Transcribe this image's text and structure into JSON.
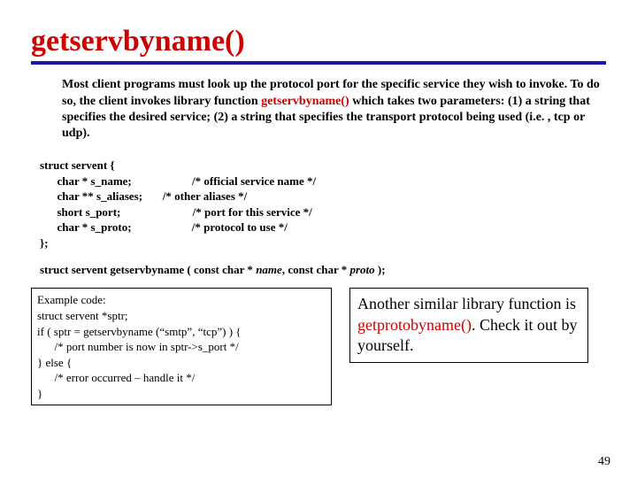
{
  "title": "getservbyname()",
  "para_prefix": "Most client programs must look up the protocol port for the specific service they wish to invoke. To do so, the client invokes library function ",
  "para_fn": "getservbyname()",
  "para_suffix": " which takes two parameters: (1) a string that specifies the desired service; (2) a string that specifies the transport protocol being used (i.e. , tcp or udp).",
  "struct_block": "struct servent {\n      char * s_name;                     /* official service name */\n      char ** s_aliases;       /* other aliases */\n      short s_port;                         /* port for this service */\n      char * s_proto;                     /* protocol to use */\n};",
  "prototype": {
    "lead": "struct servent getservbyname ( const char * ",
    "arg1": "name",
    "mid": ", const char * ",
    "arg2": "proto ",
    "end": ");"
  },
  "example_code": "Example code:\nstruct servent *sptr;\nif ( sptr = getservbyname (“smtp”, “tcp”) ) {\n      /* port number is now in sptr->s_port */\n} else {\n      /* error occurred – handle it */\n}",
  "note_prefix": "Another similar library function is ",
  "note_fn": "getprotobyname()",
  "note_suffix": ". Check it out by yourself.",
  "page_number": "49"
}
